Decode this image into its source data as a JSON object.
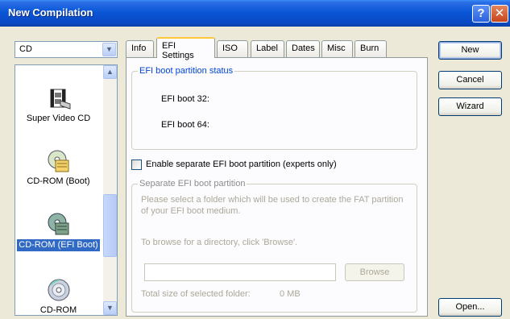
{
  "window": {
    "title": "New Compilation",
    "help_glyph": "?",
    "close_glyph": "✕"
  },
  "type_select": {
    "value": "CD"
  },
  "compilation_list": {
    "items": [
      {
        "label": "Super Video CD",
        "icon": "super-video-cd-icon",
        "selected": false
      },
      {
        "label": "CD-ROM (Boot)",
        "icon": "cdrom-boot-icon",
        "selected": false
      },
      {
        "label": "CD-ROM (EFI Boot)",
        "icon": "cdrom-efi-boot-icon",
        "selected": true
      },
      {
        "label": "CD-ROM",
        "icon": "cdrom-icon",
        "selected": false
      }
    ]
  },
  "tabs": [
    {
      "label": "Info",
      "active": false
    },
    {
      "label": "EFI Settings",
      "active": true
    },
    {
      "label": "ISO",
      "active": false
    },
    {
      "label": "Label",
      "active": false
    },
    {
      "label": "Dates",
      "active": false
    },
    {
      "label": "Misc",
      "active": false
    },
    {
      "label": "Burn",
      "active": false
    }
  ],
  "efi_status": {
    "group_title": "EFI boot partition status",
    "efi32_label": "EFI boot 32:",
    "efi64_label": "EFI boot 64:"
  },
  "separate_partition_checkbox": {
    "label": "Enable separate EFI boot partition (experts only)",
    "checked": false
  },
  "separate_partition": {
    "group_title": "Separate EFI boot partition",
    "description": "Please select a folder which will be used to create the FAT partition of your EFI boot medium.",
    "browse_hint": "To browse for a directory, click 'Browse'.",
    "folder_value": "",
    "browse_label": "Browse",
    "total_size_label": "Total size of selected folder:",
    "total_size_value": "0 MB"
  },
  "actions": {
    "new_label": "New",
    "cancel_label": "Cancel",
    "wizard_label": "Wizard",
    "open_label": "Open..."
  },
  "colors": {
    "titlebar": "#0A56D6",
    "selection": "#316AC5",
    "group_title": "#0046D5",
    "tab_highlight": "#FFC83C"
  }
}
